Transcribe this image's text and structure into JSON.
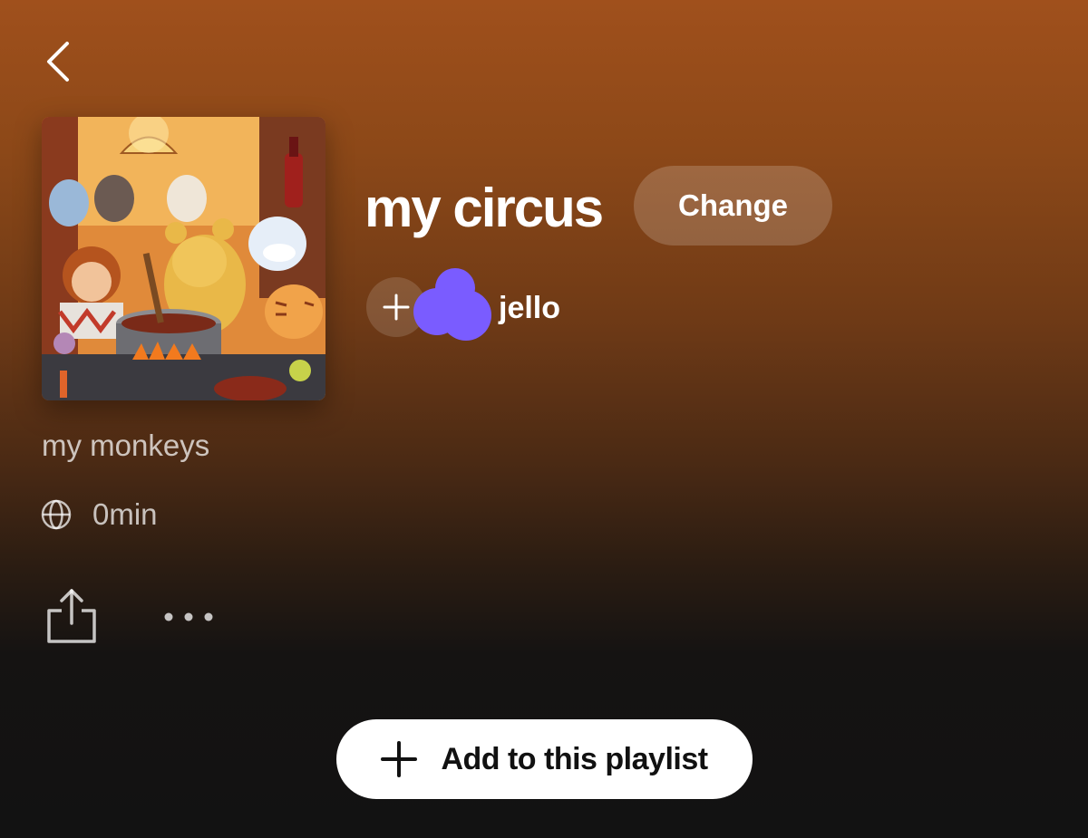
{
  "header": {
    "back_icon": "chevron-left-icon"
  },
  "playlist": {
    "cover_art": "illustrated-animals-cooking-artwork",
    "title": "my circus",
    "change_label": "Change",
    "description": "my monkeys",
    "duration": "0min",
    "visibility_icon": "globe-icon"
  },
  "owner": {
    "add_icon": "plus-icon",
    "avatar_color": "#7a5cff",
    "name": "jello"
  },
  "actions": {
    "share_icon": "share-icon",
    "more_icon": "more-horizontal-icon"
  },
  "cta": {
    "icon": "plus-icon",
    "label": "Add to this playlist"
  },
  "colors": {
    "top_gradient": "#a0501c",
    "bottom_background": "#121212",
    "button_white": "#ffffff"
  }
}
